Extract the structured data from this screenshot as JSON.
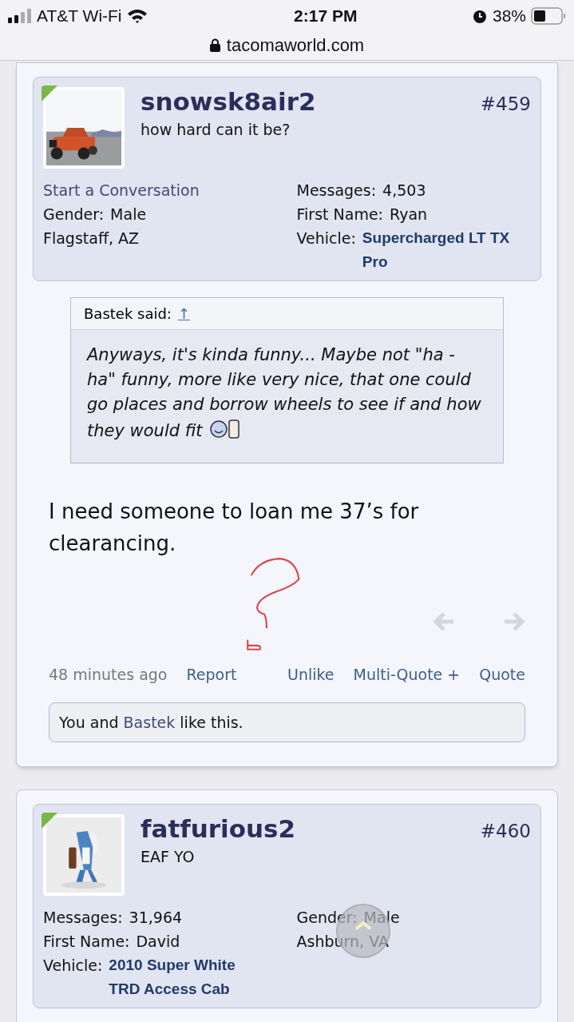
{
  "status_bar": {
    "carrier": "AT&T Wi-Fi",
    "time": "2:17 PM",
    "battery": "38%"
  },
  "address_bar": {
    "url": "tacomaworld.com"
  },
  "posts": [
    {
      "username": "snowsk8air2",
      "user_title": "how hard can it be?",
      "number": "#459",
      "avatar": {
        "kind": "picture"
      },
      "online": true,
      "info_left": [
        {
          "kind": "link",
          "text": "Start a Conversation"
        },
        {
          "kind": "field",
          "label": "Gender:",
          "value": "Male"
        },
        {
          "kind": "text",
          "text": "Flagstaff, AZ"
        }
      ],
      "info_right": [
        {
          "kind": "field",
          "label": "Messages:",
          "value": "4,503"
        },
        {
          "kind": "field",
          "label": "First Name:",
          "value": "Ryan"
        },
        {
          "kind": "vehicle",
          "label": "Vehicle:",
          "value": "Supercharged LT TX Pro"
        }
      ],
      "quote": {
        "author": "Bastek said:",
        "jump": "↑",
        "text": "Anyways, it's kinda funny... Maybe not \"ha - ha\" funny, more like very nice, that one could go places and borrow wheels to see if and how they would fit"
      },
      "message": "I need someone to loan me 37’s for clearancing.",
      "time": "48 minutes ago",
      "actions_left": [
        "Report"
      ],
      "actions_right": [
        "Unlike",
        "Multi-Quote +",
        "Quote"
      ],
      "likes": {
        "before": "You and ",
        "link": "Bastek",
        "after": " like this."
      }
    },
    {
      "username": "fatfurious2",
      "user_title": "EAF YO",
      "number": "#460",
      "avatar": {
        "kind": "picture"
      },
      "online": true,
      "info_left": [
        {
          "kind": "field",
          "label": "Messages:",
          "value": "31,964"
        },
        {
          "kind": "field",
          "label": "First Name:",
          "value": "David"
        },
        {
          "kind": "vehicle",
          "label": "Vehicle:",
          "value": "2010 Super White TRD Access Cab"
        }
      ],
      "info_right": [
        {
          "kind": "field",
          "label": "Gender:",
          "value": "Male"
        },
        {
          "kind": "text",
          "text": "Ashburn, VA"
        }
      ]
    }
  ]
}
